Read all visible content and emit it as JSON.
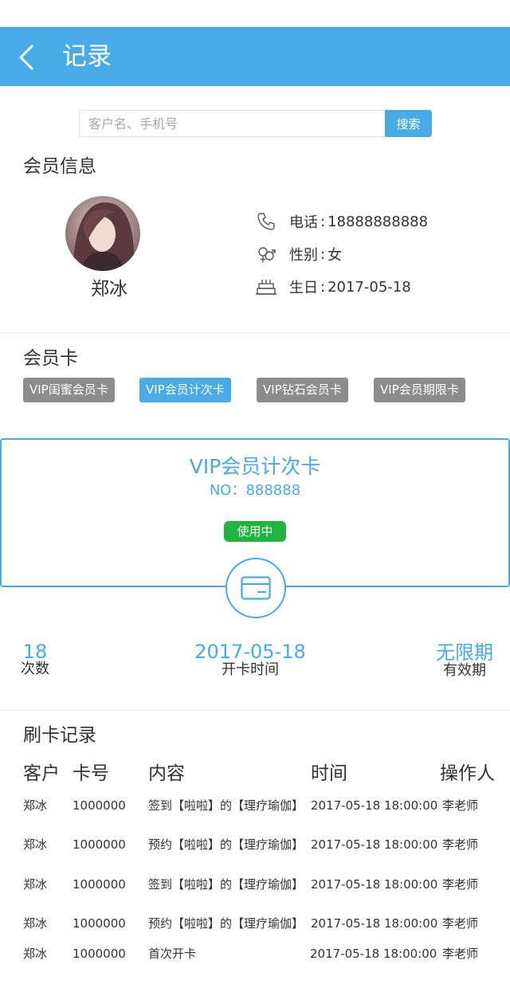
{
  "header": {
    "title": "记录"
  },
  "search": {
    "placeholder": "客户名、手机号",
    "button_label": "搜索"
  },
  "member_info": {
    "section_title": "会员信息",
    "name": "郑冰",
    "phone_label": "电话",
    "phone": "18888888888",
    "gender_label": "性别",
    "gender": "女",
    "birthday_label": "生日",
    "birthday": "2017-05-18",
    "colon": ":"
  },
  "member_cards": {
    "section_title": "会员卡",
    "tags": [
      {
        "label": "VIP闺蜜会员卡",
        "active": false
      },
      {
        "label": "VIP会员计次卡",
        "active": true
      },
      {
        "label": "VIP钻石会员卡",
        "active": false
      },
      {
        "label": "VIP会员期限卡",
        "active": false
      }
    ]
  },
  "selected_card": {
    "name": "VIP会员计次卡",
    "number": "NO：888888",
    "status": "使用中",
    "count_value": "18",
    "count_label": "次数",
    "open_date": "2017-05-18",
    "open_date_label": "开卡时间",
    "validity": "无限期",
    "validity_label": "有效期"
  },
  "records": {
    "section_title": "刷卡记录",
    "headers": [
      "客户",
      "卡号",
      "内容",
      "时间",
      "操作人"
    ],
    "rows": [
      [
        "郑冰",
        "1000000",
        "签到【啦啦】的【理疗瑜伽】",
        "2017-05-18 18:00:00",
        "李老师"
      ],
      [
        "郑冰",
        "1000000",
        "预约【啦啦】的【理疗瑜伽】",
        "2017-05-18 18:00:00",
        "李老师"
      ],
      [
        "郑冰",
        "1000000",
        "签到【啦啦】的【理疗瑜伽】",
        "2017-05-18 18:00:00",
        "李老师"
      ],
      [
        "郑冰",
        "1000000",
        "预约【啦啦】的【理疗瑜伽】",
        "2017-05-18 18:00:00",
        "李老师"
      ],
      [
        "郑冰",
        "1000000",
        "首次开卡",
        "2017-05-18 18:00:00",
        "李老师"
      ]
    ]
  },
  "colors": {
    "accent": "#48aae6",
    "active_status": "#1fb43c",
    "inactive_tag": "#8c8c8c"
  },
  "icons": [
    "back-arrow-icon",
    "phone-icon",
    "gender-icon",
    "birthday-cake-icon",
    "card-icon"
  ]
}
